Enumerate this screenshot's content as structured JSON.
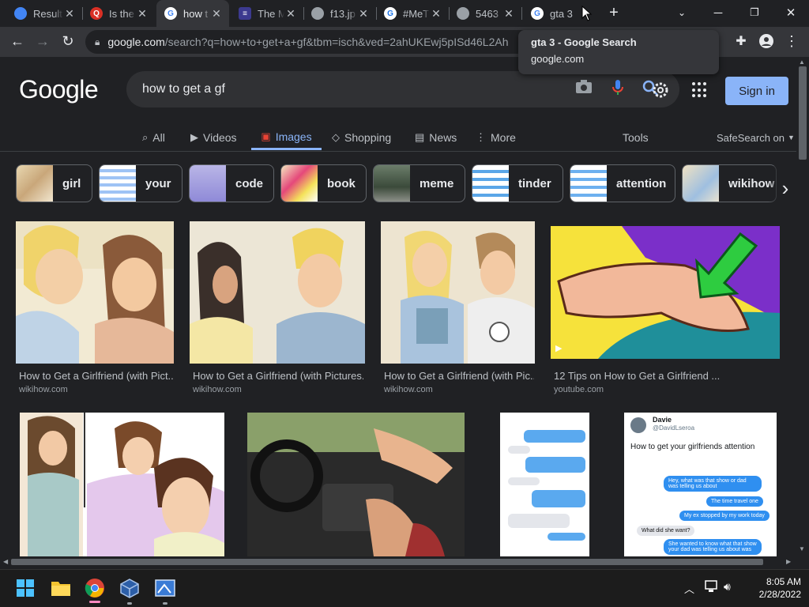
{
  "browser": {
    "tabs": [
      {
        "title": "Result",
        "color": "#4285f4",
        "glyph": "",
        "active": false
      },
      {
        "title": "Is the",
        "color": "#d93025",
        "glyph": "Q",
        "active": false
      },
      {
        "title": "how t",
        "color": "#ffffff",
        "glyph": "G",
        "active": true
      },
      {
        "title": "The M",
        "color": "#3c3a8f",
        "glyph": "≡",
        "active": false
      },
      {
        "title": "f13.jp",
        "color": "#9aa0a6",
        "glyph": "",
        "active": false
      },
      {
        "title": "#MeT",
        "color": "#1a73e8",
        "glyph": "G",
        "active": false
      },
      {
        "title": "5463",
        "color": "#9aa0a6",
        "glyph": "",
        "active": false
      },
      {
        "title": "gta 3",
        "color": "#ffffff",
        "glyph": "G",
        "active": false
      }
    ],
    "close_glyph": "✕",
    "new_tab_glyph": "+",
    "url_host": "google.com",
    "url_path": "/search?q=how+to+get+a+gf&tbm=isch&ved=2ahUKEwj5pISd46L2Ah",
    "tooltip": {
      "title": "gta 3 - Google Search",
      "host": "google.com"
    }
  },
  "google": {
    "logo": "Google",
    "query": "how to get a gf",
    "sign_in": "Sign in",
    "tabs": [
      {
        "label": "All",
        "icon": "⌕",
        "active": false
      },
      {
        "label": "Videos",
        "icon": "▶",
        "active": false
      },
      {
        "label": "Images",
        "icon": "▣",
        "active": true
      },
      {
        "label": "Shopping",
        "icon": "◇",
        "active": false
      },
      {
        "label": "News",
        "icon": "▤",
        "active": false
      },
      {
        "label": "More",
        "icon": "⋮",
        "active": false
      }
    ],
    "tools": "Tools",
    "safesearch": "SafeSearch on",
    "chips": [
      "girl",
      "your",
      "code",
      "book",
      "meme",
      "tinder",
      "attention",
      "wikihow"
    ],
    "results_row1": [
      {
        "caption": "How to Get a Girlfriend (with Pict...",
        "source": "wikihow.com"
      },
      {
        "caption": "How to Get a Girlfriend (with Pictures...",
        "source": "wikihow.com"
      },
      {
        "caption": "How to Get a Girlfriend (with Pic...",
        "source": "wikihow.com"
      },
      {
        "caption": "12 Tips on How to Get a Girlfriend ...",
        "source": "youtube.com"
      }
    ],
    "row2_tweet": {
      "name": "Davie",
      "handle": "@DavidLseroa",
      "text": "How to get your girlfriends attention",
      "bubbles": [
        "Hey, what was that show or dad was telling us about",
        "The time travel one",
        "My ex stopped by my work today",
        "What did she want?",
        "She wanted to know what that show your dad was telling us about was"
      ]
    }
  },
  "taskbar": {
    "time": "8:05 AM",
    "date": "2/28/2022"
  }
}
